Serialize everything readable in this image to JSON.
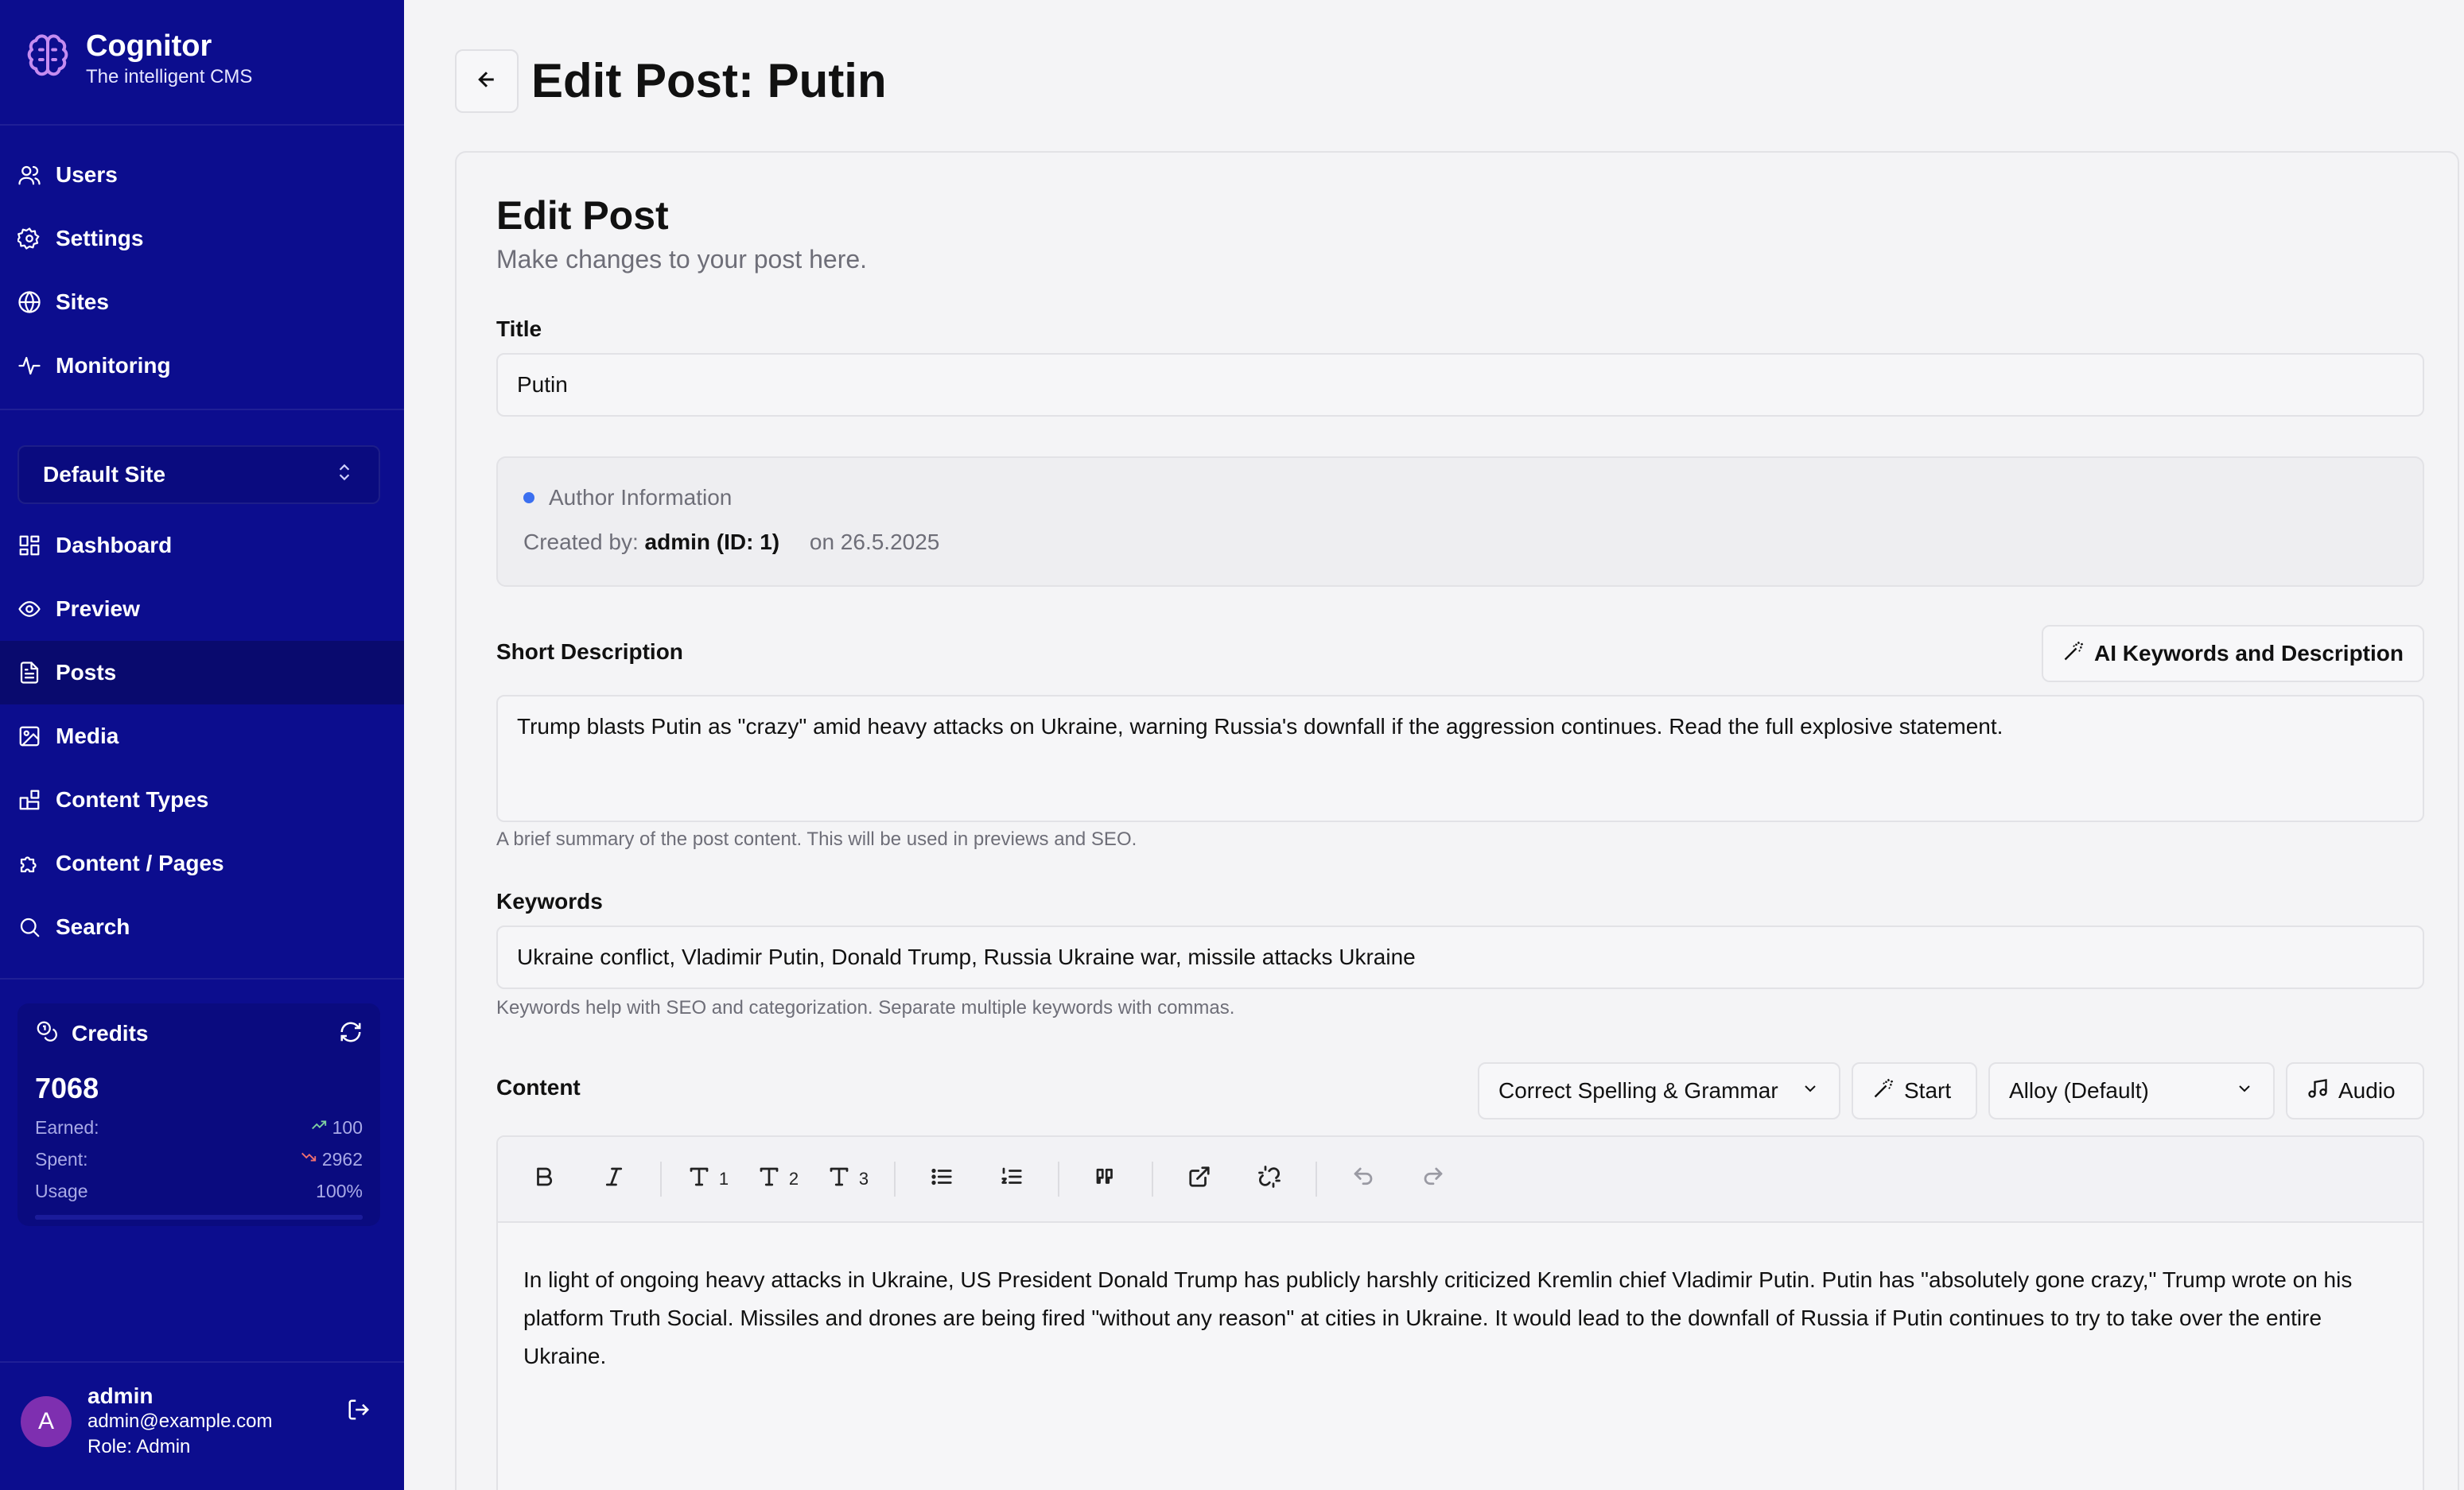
{
  "brand": {
    "title": "Cognitor",
    "subtitle": "The intelligent CMS"
  },
  "nav_top": [
    {
      "label": "Users",
      "icon": "users-icon"
    },
    {
      "label": "Settings",
      "icon": "gear-icon"
    },
    {
      "label": "Sites",
      "icon": "globe-icon"
    },
    {
      "label": "Monitoring",
      "icon": "activity-icon"
    }
  ],
  "site_select": {
    "value": "Default Site"
  },
  "nav_site": [
    {
      "label": "Dashboard",
      "icon": "dashboard-icon"
    },
    {
      "label": "Preview",
      "icon": "eye-icon"
    },
    {
      "label": "Posts",
      "icon": "document-icon",
      "active": true
    },
    {
      "label": "Media",
      "icon": "image-icon"
    },
    {
      "label": "Content Types",
      "icon": "blocks-icon"
    },
    {
      "label": "Content / Pages",
      "icon": "puzzle-icon"
    },
    {
      "label": "Search",
      "icon": "search-icon"
    }
  ],
  "credits": {
    "title": "Credits",
    "value": "7068",
    "earned_label": "Earned:",
    "earned_value": "100",
    "spent_label": "Spent:",
    "spent_value": "2962",
    "usage_label": "Usage",
    "usage_value": "100%",
    "usage_fraction": 1.0
  },
  "user": {
    "initial": "A",
    "name": "admin",
    "email": "admin@example.com",
    "role": "Role: Admin"
  },
  "page": {
    "title": "Edit Post: Putin"
  },
  "card": {
    "title": "Edit Post",
    "subtitle": "Make changes to your post here."
  },
  "form": {
    "title_label": "Title",
    "title_value": "Putin",
    "author_heading": "Author Information",
    "created_by_label": "Created by:",
    "created_by_value": "admin (ID: 1)",
    "created_on": "on 26.5.2025",
    "short_desc_label": "Short Description",
    "ai_button": "AI Keywords and Description",
    "short_desc_value": "Trump blasts Putin as \"crazy\" amid heavy attacks on Ukraine, warning Russia's downfall if the aggression continues. Read the full explosive statement.",
    "short_desc_help": "A brief summary of the post content. This will be used in previews and SEO.",
    "keywords_label": "Keywords",
    "keywords_value": "Ukraine conflict, Vladimir Putin, Donald Trump, Russia Ukraine war, missile attacks Ukraine",
    "keywords_help": "Keywords help with SEO and categorization. Separate multiple keywords with commas.",
    "content_label": "Content",
    "ai_action_select": "Correct Spelling & Grammar",
    "start_button": "Start",
    "voice_select": "Alloy (Default)",
    "audio_button": "Audio",
    "toolbar": {
      "h1": "1",
      "h2": "2",
      "h3": "3"
    },
    "content_value": "In light of ongoing heavy attacks in Ukraine, US President Donald Trump has publicly harshly criticized Kremlin chief Vladimir Putin. Putin has \"absolutely gone crazy,\" Trump wrote on his platform Truth Social. Missiles and drones are being fired \"without any reason\" at cities in Ukraine. It would lead to the downfall of Russia if Putin continues to try to take over the entire Ukraine."
  }
}
